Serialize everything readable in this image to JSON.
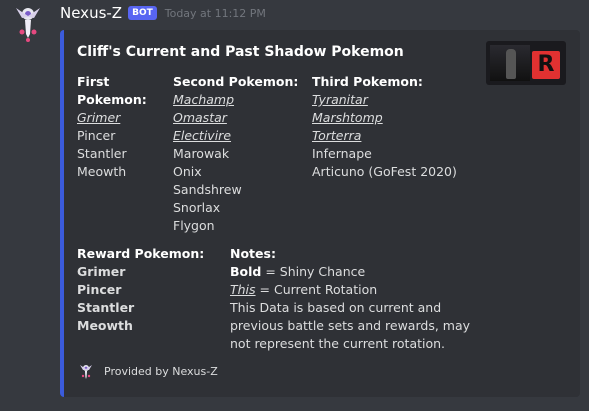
{
  "message": {
    "username": "Nexus-Z",
    "bot_tag": "BOT",
    "timestamp": "Today at 11:12 PM",
    "avatar_icon": "nexus-z-avatar-icon"
  },
  "embed": {
    "accent_color": "#3b5bdb",
    "title": "Cliff's Current and Past Shadow Pokemon",
    "thumbnail_icon": "team-rocket-cliff-thumbnail",
    "thumbnail_letter": "R",
    "fields": [
      {
        "name": "First Pokemon:",
        "values": [
          {
            "text": "Grimer",
            "current": true
          },
          {
            "text": "Pincer",
            "current": false
          },
          {
            "text": "Stantler",
            "current": false
          },
          {
            "text": "Meowth",
            "current": false
          }
        ]
      },
      {
        "name": "Second Pokemon:",
        "values": [
          {
            "text": "Machamp",
            "current": true
          },
          {
            "text": "Omastar",
            "current": true
          },
          {
            "text": "Electivire",
            "current": true
          },
          {
            "text": "Marowak",
            "current": false
          },
          {
            "text": "Onix",
            "current": false
          },
          {
            "text": "Sandshrew",
            "current": false
          },
          {
            "text": "Snorlax",
            "current": false
          },
          {
            "text": "Flygon",
            "current": false
          }
        ]
      },
      {
        "name": "Third Pokemon:",
        "values": [
          {
            "text": "Tyranitar",
            "current": true
          },
          {
            "text": "Marshtomp",
            "current": true
          },
          {
            "text": "Torterra",
            "current": true
          },
          {
            "text": "Infernape",
            "current": false
          },
          {
            "text": "Articuno (GoFest 2020)",
            "current": false
          }
        ]
      },
      {
        "name": "Reward Pokemon:",
        "values": [
          {
            "text": "Grimer",
            "bold": true
          },
          {
            "text": "Pincer",
            "bold": true
          },
          {
            "text": "Stantler",
            "bold": true
          },
          {
            "text": "Meowth",
            "bold": true
          }
        ]
      },
      {
        "name": "Notes:",
        "notes": {
          "bold_key": "Bold",
          "bold_desc": " = Shiny Chance",
          "this_key": "This",
          "this_desc": " = Current Rotation",
          "line3": "This Data is based on current and",
          "line4": "previous battle sets and rewards, may",
          "line5": "not represent the current rotation."
        }
      }
    ],
    "footer": {
      "text": "Provided by Nexus-Z",
      "icon": "nexus-z-footer-icon"
    }
  }
}
